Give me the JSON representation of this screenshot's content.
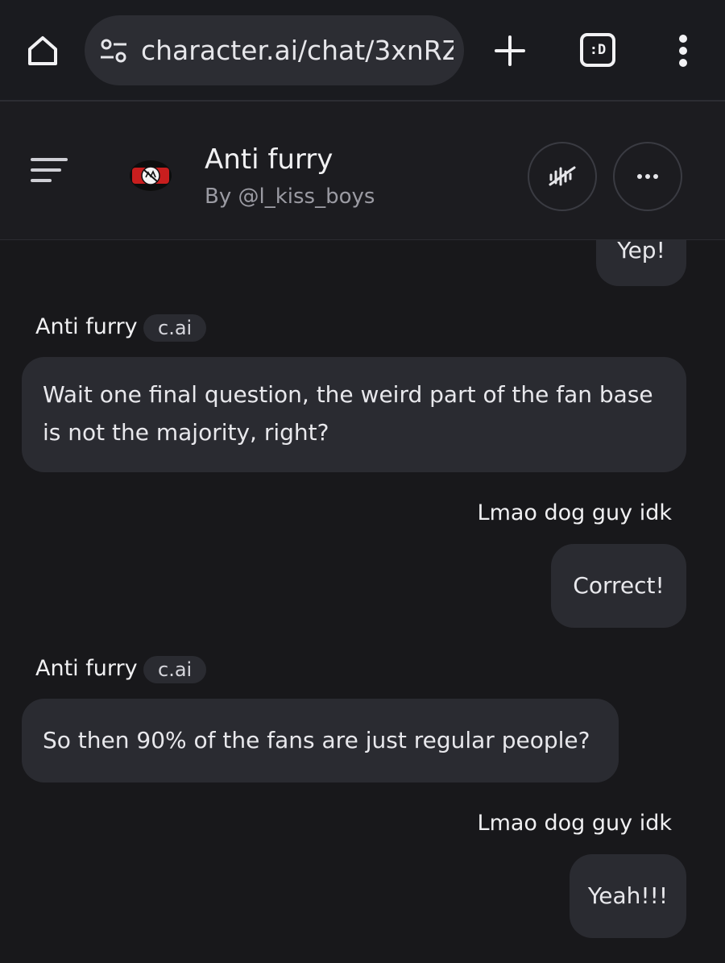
{
  "browser": {
    "url": "character.ai/chat/3xnRZ",
    "tabs_count_label": ":D"
  },
  "header": {
    "character_name": "Anti furry",
    "author": "By @l_kiss_boys"
  },
  "messages": [
    {
      "sender": "user",
      "text": "Yep!"
    },
    {
      "sender": "character",
      "name": "Anti furry",
      "badge": "c.ai",
      "text": "Wait one final question, the weird part of the fan base is not the majority, right?"
    },
    {
      "sender": "user",
      "name": "Lmao dog guy idk",
      "text": "Correct!"
    },
    {
      "sender": "character",
      "name": "Anti furry",
      "badge": "c.ai",
      "text": "So then 90% of the fans are just regular people?"
    },
    {
      "sender": "user",
      "name": "Lmao dog guy idk",
      "text": "Yeah!!!"
    }
  ],
  "icons": {
    "home": "home-icon",
    "site_settings": "tune-icon",
    "new_tab": "plus-icon",
    "tabs": "tab-switcher-icon",
    "browser_menu": "kebab-menu-icon",
    "sidebar": "hamburger-menu-icon",
    "voice": "voice-off-icon",
    "more": "more-horizontal-icon"
  },
  "colors": {
    "background": "#18181b",
    "bubble": "#2a2b31",
    "header": "#1c1c20"
  }
}
